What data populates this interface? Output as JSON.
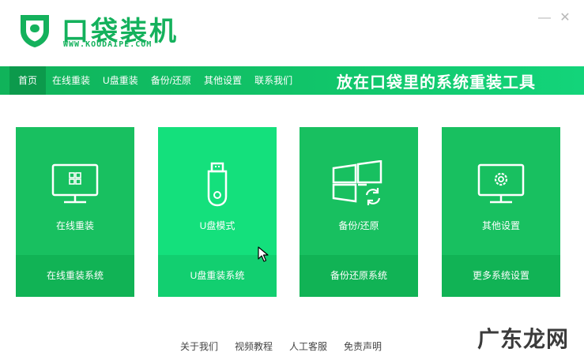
{
  "brand": {
    "title": "口袋装机",
    "subtitle": "WWW.KOUDAIPE.COM",
    "color": "#14b15c"
  },
  "window_controls": {
    "minimize_icon": "minimize-icon",
    "close_icon": "close-icon"
  },
  "nav": {
    "items": [
      {
        "label": "首页",
        "active": true
      },
      {
        "label": "在线重装",
        "active": false
      },
      {
        "label": "U盘重装",
        "active": false
      },
      {
        "label": "备份/还原",
        "active": false
      },
      {
        "label": "其他设置",
        "active": false
      },
      {
        "label": "联系我们",
        "active": false
      }
    ],
    "slogan": "放在口袋里的系统重装工具"
  },
  "cards": [
    {
      "label": "在线重装",
      "action": "在线重装系统",
      "icon": "monitor-windows-icon"
    },
    {
      "label": "U盘模式",
      "action": "U盘重装系统",
      "icon": "usb-drive-icon"
    },
    {
      "label": "备份/还原",
      "action": "备份还原系统",
      "icon": "windows-restore-icon"
    },
    {
      "label": "其他设置",
      "action": "更多系统设置",
      "icon": "monitor-gear-icon"
    }
  ],
  "footer": {
    "links": [
      "关于我们",
      "视频教程",
      "人工客服",
      "免责声明"
    ]
  },
  "watermark": "广东龙网",
  "colors": {
    "primary": "#18c060",
    "primary_dark": "#11b355",
    "highlight": "#14e07c",
    "nav_active": "#0c9a4c"
  }
}
